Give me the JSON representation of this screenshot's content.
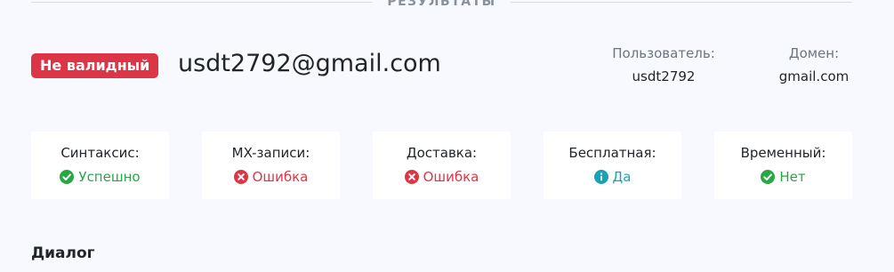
{
  "section": {
    "title": "РЕЗУЛЬТАТЫ"
  },
  "result": {
    "badge": "Не валидный",
    "email": "usdt2792@gmail.com"
  },
  "meta": {
    "user_label": "Пользователь:",
    "user_value": "usdt2792",
    "domain_label": "Домен:",
    "domain_value": "gmail.com"
  },
  "checks": [
    {
      "label": "Синтаксис:",
      "status": "Успешно",
      "icon": "check-circle-icon",
      "color": "#28a745"
    },
    {
      "label": "MX-записи:",
      "status": "Ошибка",
      "icon": "times-circle-icon",
      "color": "#dc3545"
    },
    {
      "label": "Доставка:",
      "status": "Ошибка",
      "icon": "times-circle-icon",
      "color": "#dc3545"
    },
    {
      "label": "Бесплатная:",
      "status": "Да",
      "icon": "info-circle-icon",
      "color": "#17a2b8"
    },
    {
      "label": "Временный:",
      "status": "Нет",
      "icon": "check-circle-icon",
      "color": "#28a745"
    }
  ],
  "dialog": {
    "title": "Диалог"
  }
}
